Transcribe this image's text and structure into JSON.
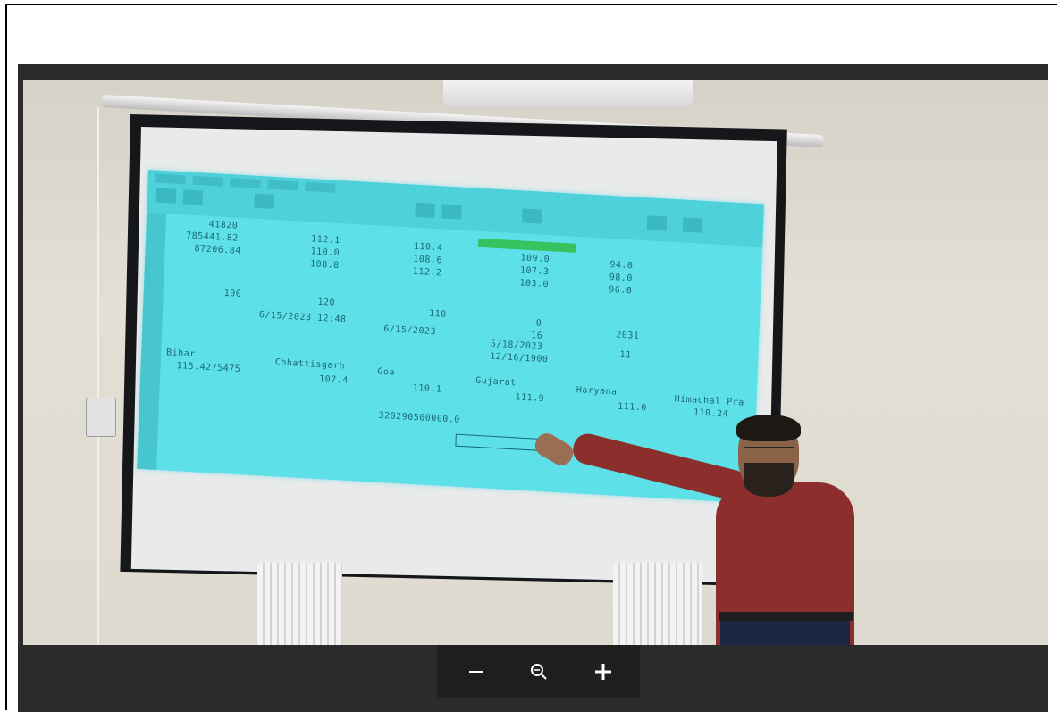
{
  "viewer": {
    "background": "#2b2b2b",
    "toolbar_background": "#1f1f1f",
    "controls": [
      {
        "name": "zoom-out",
        "icon": "minus-icon",
        "label": "—"
      },
      {
        "name": "zoom-reset",
        "icon": "magnifier-icon",
        "label": "🔍"
      },
      {
        "name": "zoom-in",
        "icon": "plus-icon",
        "label": "+"
      }
    ]
  },
  "photo": {
    "projected_spreadsheet": {
      "accent": "#5ee0e8",
      "cells": [
        "41820",
        "785441.82",
        "87206.84",
        "112.1",
        "110.0",
        "108.8",
        "110.4",
        "108.6",
        "112.2",
        "109.0",
        "107.3",
        "103.0",
        "94.0",
        "98.0",
        "96.0",
        "100",
        "120",
        "110",
        "0",
        "16",
        "2031",
        "6/15/2023 12:48",
        "6/15/2023",
        "5/18/2023",
        "12/16/1900",
        "11",
        "Bihar",
        "Chhattisgarh",
        "Goa",
        "Gujarat",
        "Haryana",
        "Himachal Pra",
        "115.4275475",
        "107.4",
        "110.1",
        "111.9",
        "111.0",
        "110.24",
        "320290500000.0"
      ]
    }
  }
}
